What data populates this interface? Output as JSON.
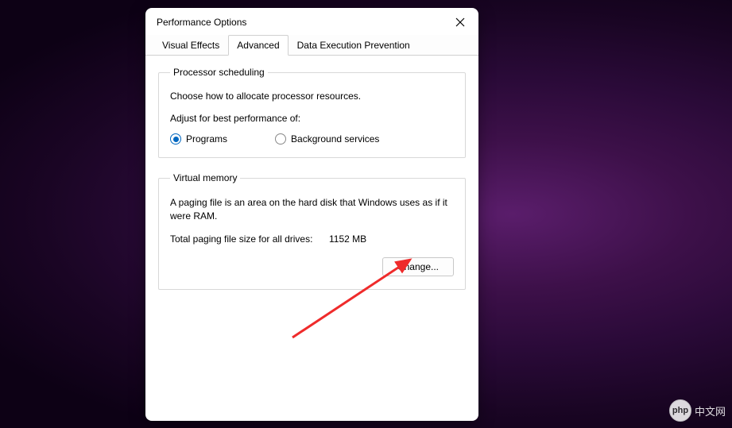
{
  "dialog": {
    "title": "Performance Options",
    "tabs": [
      {
        "label": "Visual Effects"
      },
      {
        "label": "Advanced"
      },
      {
        "label": "Data Execution Prevention"
      }
    ]
  },
  "processor": {
    "legend": "Processor scheduling",
    "desc": "Choose how to allocate processor resources.",
    "subhead": "Adjust for best performance of:",
    "opt_programs": "Programs",
    "opt_bg": "Background services"
  },
  "vm": {
    "legend": "Virtual memory",
    "desc": "A paging file is an area on the hard disk that Windows uses as if it were RAM.",
    "total_label": "Total paging file size for all drives:",
    "total_value": "1152 MB",
    "change_btn": "Change..."
  },
  "watermark": {
    "logo": "php",
    "text": "中文网"
  }
}
